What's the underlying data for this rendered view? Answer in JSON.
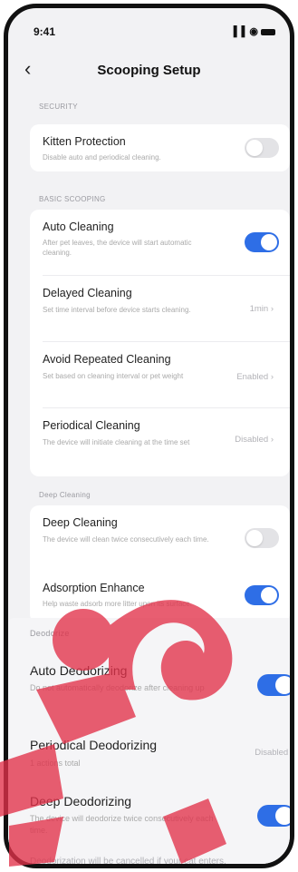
{
  "status_bar": {
    "time": "9:41",
    "icons": "▐▐ ◉"
  },
  "nav": {
    "back_icon": "‹",
    "title": "Scooping Setup"
  },
  "sections": {
    "security": "SECURITY",
    "basic": "BASIC SCOOPING",
    "deep": "Deep Cleaning",
    "deodorize": "Deodorize"
  },
  "security_rows": [
    {
      "title": "Kitten Protection",
      "subtitle": "Disable auto and periodical cleaning.",
      "toggle": "off"
    }
  ],
  "basic_rows": [
    {
      "title": "Auto Cleaning",
      "subtitle": "After pet leaves, the device will start automatic cleaning.",
      "toggle": "on"
    },
    {
      "title": "Delayed Cleaning",
      "subtitle": "Set time interval before device starts cleaning.",
      "value": "1min"
    },
    {
      "title": "Avoid Repeated Cleaning",
      "subtitle": "Set based on cleaning interval or pet weight",
      "value": "Enabled"
    },
    {
      "title": "Periodical Cleaning",
      "subtitle": "The device will initiate cleaning at the time set",
      "value": "Disabled"
    }
  ],
  "deep_rows": [
    {
      "title": "Deep Cleaning",
      "subtitle": "The device will clean twice consecutively each time.",
      "toggle": "off"
    },
    {
      "title": "Adsorption Enhance",
      "subtitle": "Help waste adsorb more litter upon its surface.",
      "toggle": "on"
    }
  ],
  "deodorize_rows": [
    {
      "title": "Auto Deodorizing",
      "subtitle": "Do not automatically deodorize after cleaning up",
      "toggle": "on"
    },
    {
      "title": "Periodical Deodorizing",
      "subtitle": "1 actions total",
      "value": "Disabled"
    },
    {
      "title": "Deep Deodorizing",
      "subtitle": "The device will deodorize twice consecutively each time.",
      "toggle": "on"
    }
  ],
  "deodorize_footer": "Deodorization will be cancelled if your cat enters.",
  "chevron": "›",
  "colors": {
    "accent": "#2e6ee6",
    "watermark": "#e2324a"
  }
}
